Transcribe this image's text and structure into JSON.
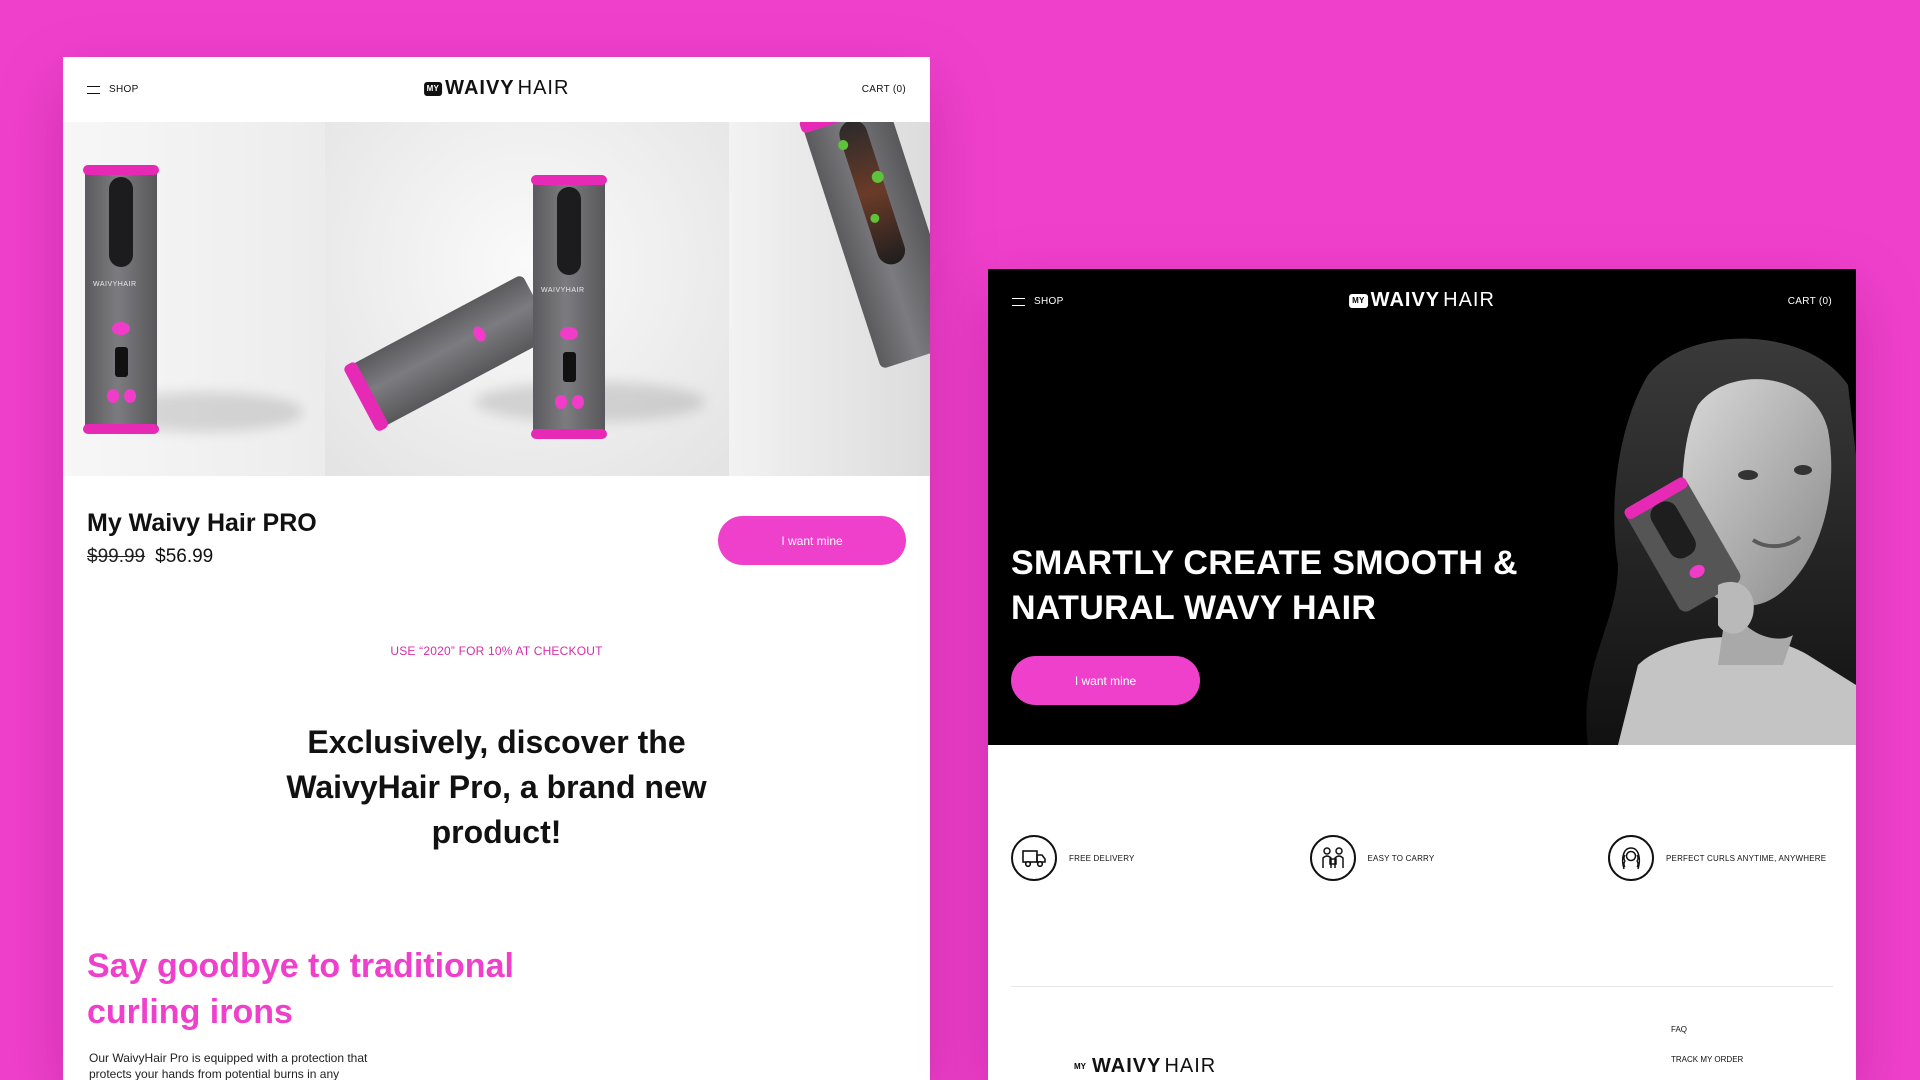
{
  "brand": {
    "badge": "MY",
    "bold": "WAIVY",
    "thin": "HAIR"
  },
  "colors": {
    "background": "#ef40cc",
    "accent": "#ef40cc",
    "promo": "#d62ea8",
    "dark": "#000000"
  },
  "left_page": {
    "nav": {
      "menu_label": "SHOP",
      "cart_label": "CART (0)"
    },
    "product": {
      "title": "My Waivy Hair PRO",
      "old_price": "$99.99",
      "price": "$56.99",
      "cta": "I want mine"
    },
    "device_brand": "WAIVYHAIR",
    "promo": "USE “2020” FOR 10% AT CHECKOUT",
    "headline": "Exclusively, discover the WaivyHair Pro, a brand new product!",
    "pink_heading": "Say goodbye to traditional curling irons",
    "body": "Our WaivyHair Pro is equipped with a protection that protects your hands from potential burns in any"
  },
  "right_page": {
    "nav": {
      "menu_label": "SHOP",
      "cart_label": "CART (0)"
    },
    "hero": {
      "title": "SMARTLY CREATE SMOOTH & NATURAL WAVY HAIR",
      "cta": "I want mine"
    },
    "features": [
      {
        "icon": "delivery-truck-icon",
        "label": "FREE DELIVERY"
      },
      {
        "icon": "carry-icon",
        "label": "EASY TO CARRY"
      },
      {
        "icon": "curls-icon",
        "label": "PERFECT CURLS ANYTIME, ANYWHERE"
      }
    ],
    "footer_links": [
      "FAQ",
      "TRACK MY ORDER"
    ]
  }
}
